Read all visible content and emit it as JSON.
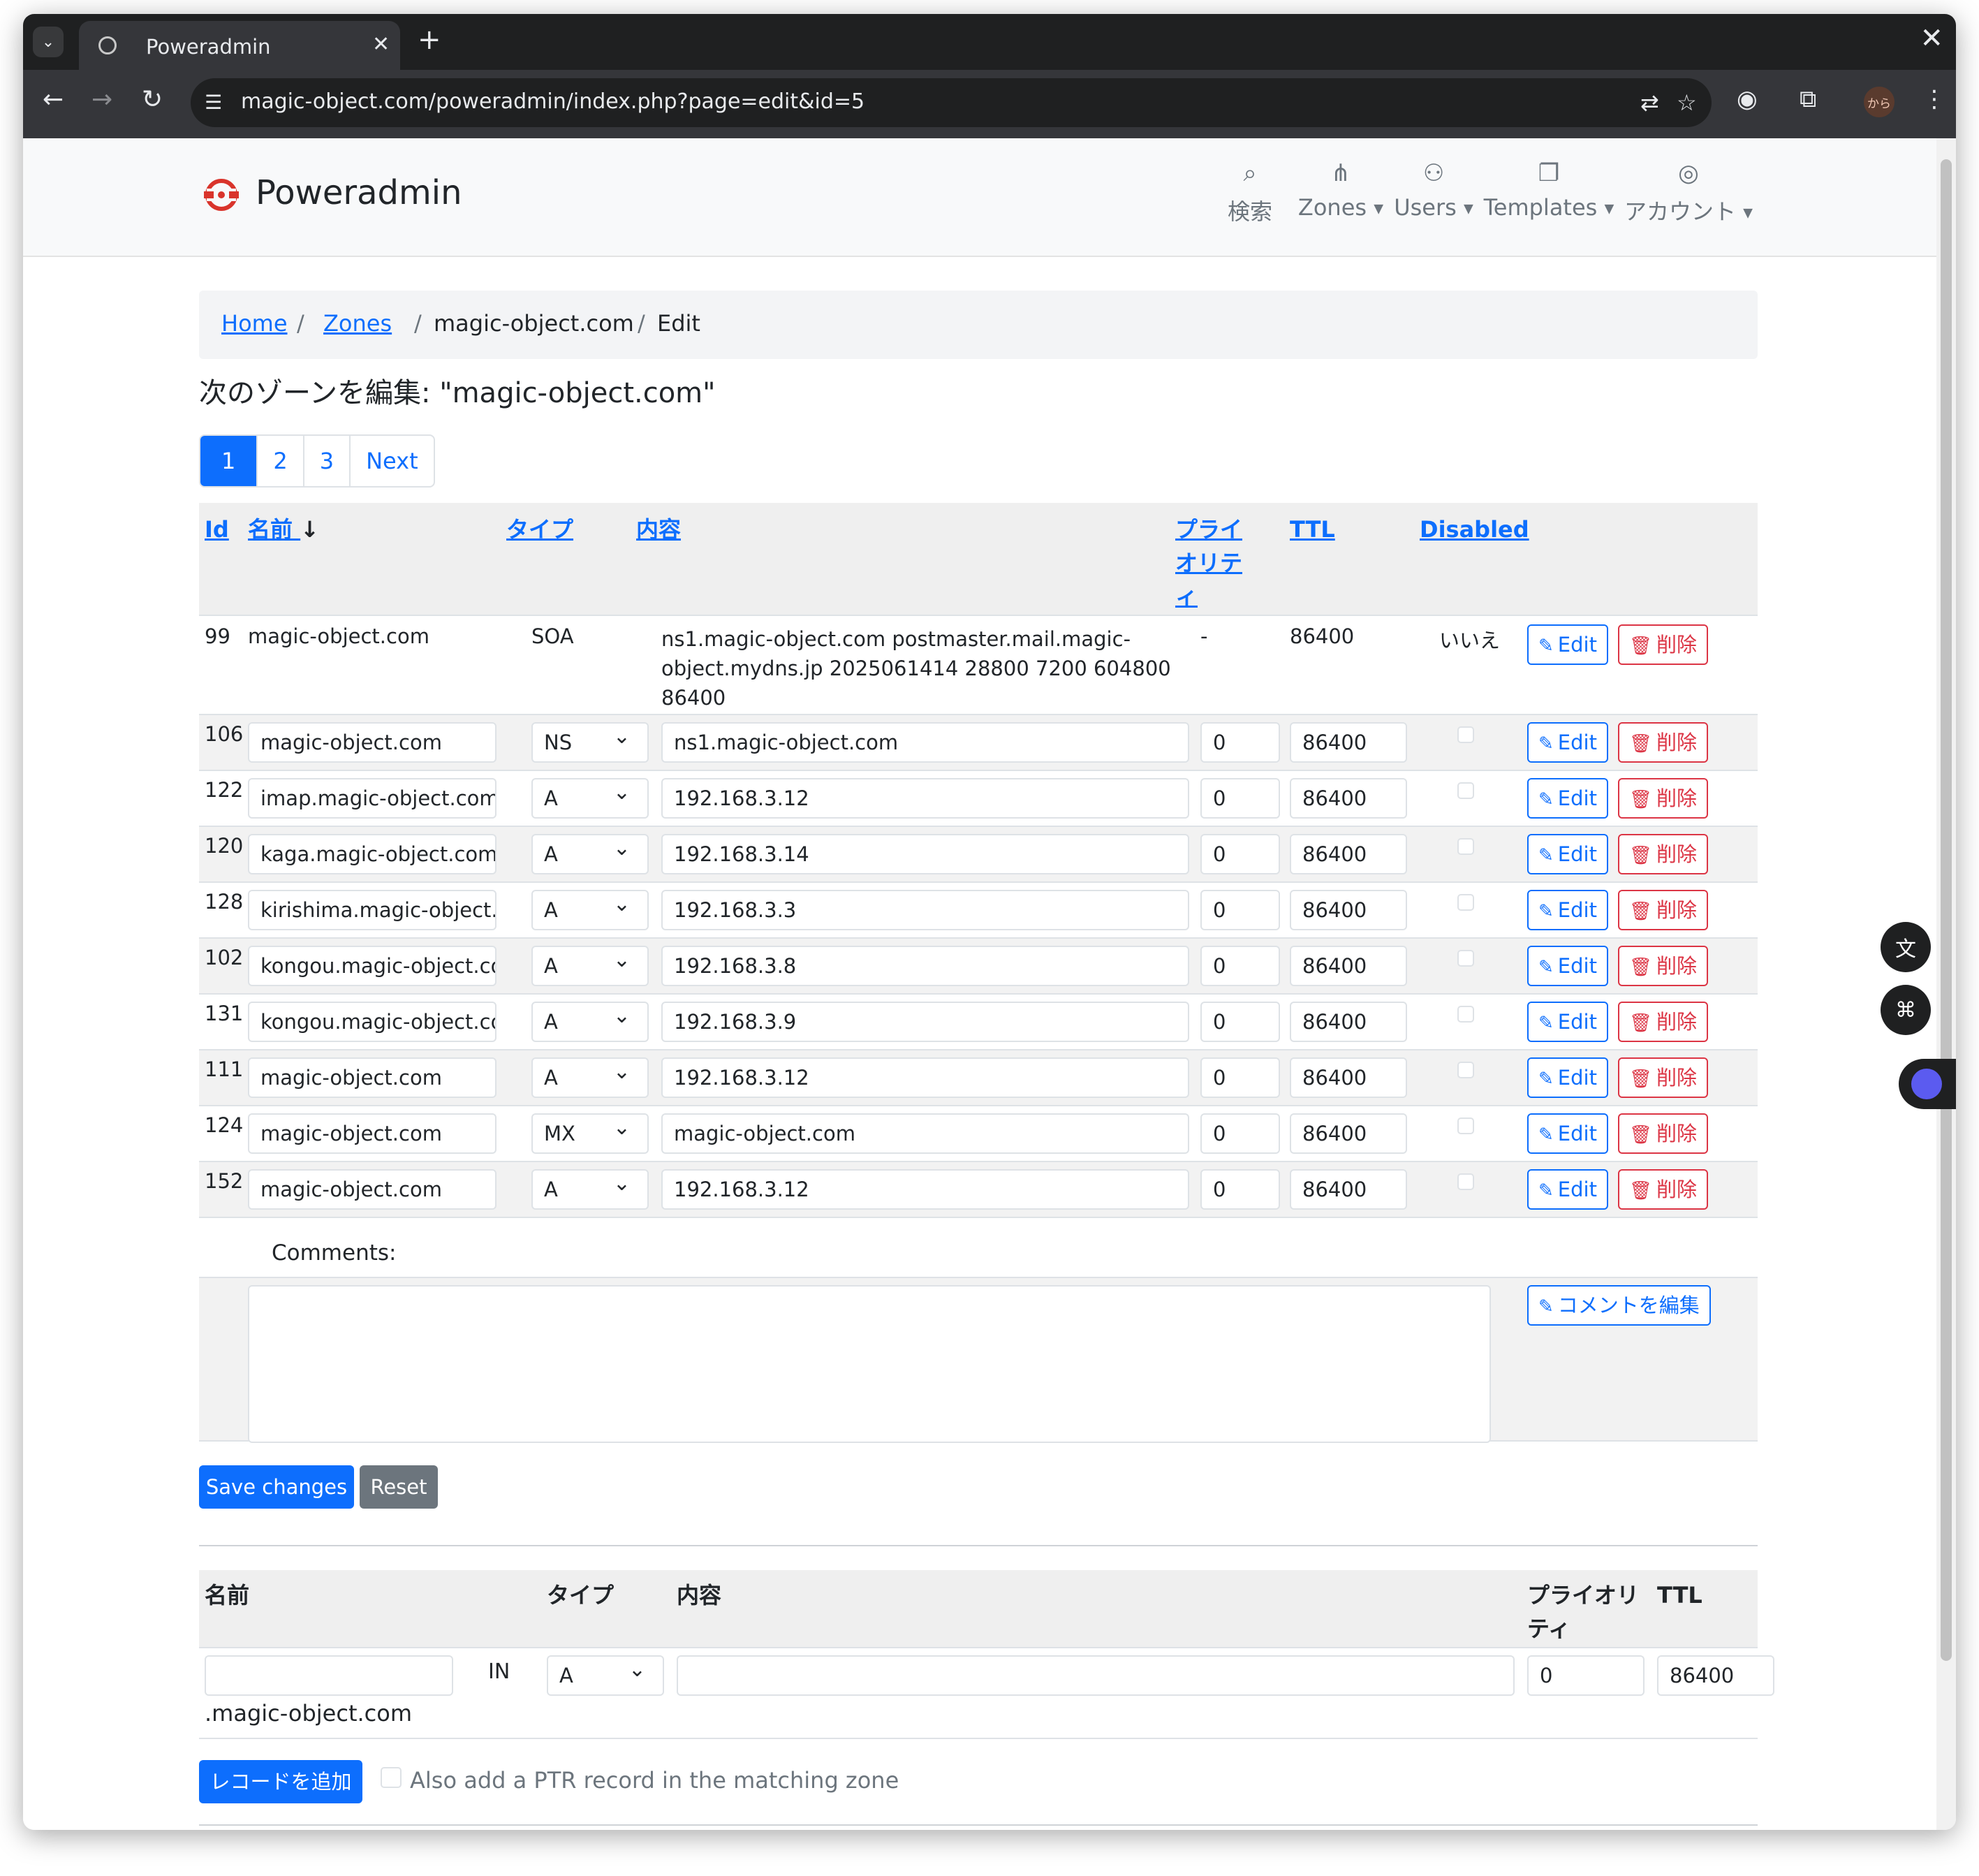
{
  "browser": {
    "tab_title": "Poweradmin",
    "tab_close": "✕",
    "new_tab": "+",
    "window_close": "✕",
    "url": "magic-object.com/poweradmin/index.php?page=edit&id=5",
    "profile_label": "から"
  },
  "site": {
    "brand": "Poweradmin",
    "accent_color": "#0d6efd",
    "danger_color": "#dc3545",
    "nav": [
      {
        "label": "検索",
        "icon": "search-icon",
        "dropdown": false
      },
      {
        "label": "Zones",
        "icon": "sitemap-icon",
        "dropdown": true
      },
      {
        "label": "Users",
        "icon": "users-icon",
        "dropdown": true
      },
      {
        "label": "Templates",
        "icon": "copy-icon",
        "dropdown": true
      },
      {
        "label": "アカウント",
        "icon": "user-circle-icon",
        "dropdown": true
      }
    ]
  },
  "breadcrumb": {
    "home": "Home",
    "zones": "Zones",
    "zone": "magic-object.com",
    "current": "Edit",
    "separator": "/"
  },
  "page_title": "次のゾーンを編集: \"magic-object.com\"",
  "pagination": [
    "1",
    "2",
    "3",
    "Next"
  ],
  "table": {
    "headers": {
      "id": "Id",
      "name": "名前",
      "type": "タイプ",
      "content": "内容",
      "priority_1": "プライ",
      "priority_2": "オリテ",
      "priority_3": "ィ",
      "ttl": "TTL",
      "disabled": "Disabled",
      "sort_indicator": "↓"
    },
    "soa": {
      "id": "99",
      "name": "magic-object.com",
      "type": "SOA",
      "content_1": "ns1.magic-object.com postmaster.mail.magic-",
      "content_2": "object.mydns.jp 2025061414 28800 7200 604800",
      "content_3": "86400",
      "priority": "-",
      "ttl": "86400",
      "disabled": "いいえ"
    },
    "rows": [
      {
        "id": "106",
        "name": "magic-object.com",
        "type": "NS",
        "content": "ns1.magic-object.com",
        "priority": "0",
        "ttl": "86400"
      },
      {
        "id": "122",
        "name": "imap.magic-object.com",
        "type": "A",
        "content": "192.168.3.12",
        "priority": "0",
        "ttl": "86400"
      },
      {
        "id": "120",
        "name": "kaga.magic-object.com",
        "type": "A",
        "content": "192.168.3.14",
        "priority": "0",
        "ttl": "86400"
      },
      {
        "id": "128",
        "name": "kirishima.magic-object.c",
        "type": "A",
        "content": "192.168.3.3",
        "priority": "0",
        "ttl": "86400"
      },
      {
        "id": "102",
        "name": "kongou.magic-object.co",
        "type": "A",
        "content": "192.168.3.8",
        "priority": "0",
        "ttl": "86400"
      },
      {
        "id": "131",
        "name": "kongou.magic-object.co",
        "type": "A",
        "content": "192.168.3.9",
        "priority": "0",
        "ttl": "86400"
      },
      {
        "id": "111",
        "name": "magic-object.com",
        "type": "A",
        "content": "192.168.3.12",
        "priority": "0",
        "ttl": "86400"
      },
      {
        "id": "124",
        "name": "magic-object.com",
        "type": "MX",
        "content": "magic-object.com",
        "priority": "0",
        "ttl": "86400"
      },
      {
        "id": "152",
        "name": "magic-object.com",
        "type": "A",
        "content": "192.168.3.12",
        "priority": "0",
        "ttl": "86400"
      }
    ],
    "edit_label": "Edit",
    "delete_label": "削除"
  },
  "comments": {
    "label": "Comments:",
    "edit_button": "コメントを編集",
    "value": ""
  },
  "actions": {
    "save": "Save changes",
    "reset": "Reset"
  },
  "add_record": {
    "headers": {
      "name": "名前",
      "type": "タイプ",
      "content": "内容",
      "priority_1": "プライオリ",
      "priority_2": "ティ",
      "ttl": "TTL"
    },
    "name_value": "",
    "in_label": "IN",
    "zone_suffix": ".magic-object.com",
    "type_value": "A",
    "content_value": "",
    "priority_value": "0",
    "ttl_value": "86400",
    "add_button": "レコードを追加",
    "ptr_label": "Also add a PTR record in the matching zone"
  }
}
